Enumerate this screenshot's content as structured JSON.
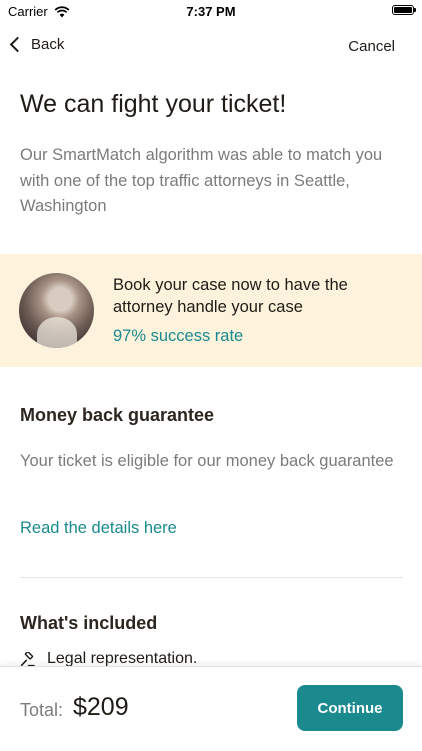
{
  "status_bar": {
    "carrier": "Carrier",
    "time": "7:37 PM"
  },
  "nav": {
    "back_label": "Back",
    "cancel_label": "Cancel"
  },
  "header": {
    "title": "We can fight your ticket!",
    "intro": "Our SmartMatch algorithm was able to match you with one of the top traffic attorneys in Seattle, Washington"
  },
  "attorney": {
    "book_text": "Book your case now to have the attorney handle your case",
    "success_rate": "97% success rate"
  },
  "guarantee": {
    "title": "Money back guarantee",
    "text": "Your ticket is eligible for our money back guarantee",
    "link": "Read the details here"
  },
  "included": {
    "title": "What's included",
    "items": [
      {
        "label": "Legal representation.",
        "icon": "gavel-icon"
      }
    ]
  },
  "footer": {
    "total_label": "Total:",
    "total_value": "$209",
    "continue_label": "Continue"
  },
  "colors": {
    "accent": "#1b8a8f",
    "band_background": "#fdf2dc",
    "muted_text": "#7b7b7b"
  }
}
